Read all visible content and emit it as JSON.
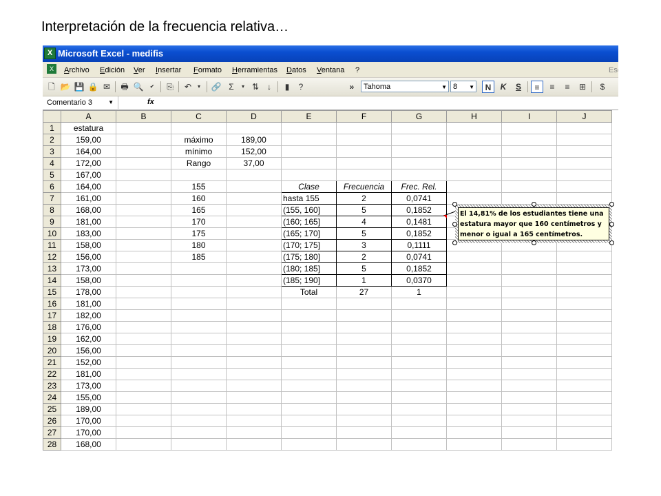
{
  "slide_title": "Interpretación de la frecuencia relativa…",
  "window": {
    "title": "Microsoft Excel - medifis"
  },
  "menu": [
    "Archivo",
    "Edición",
    "Ver",
    "Insertar",
    "Formato",
    "Herramientas",
    "Datos",
    "Ventana",
    "?"
  ],
  "help_box": "Esc",
  "toolbar": {
    "font_name": "Tahoma",
    "font_size": "8",
    "bold_label": "N",
    "italic_label": "K",
    "underline_label": "S",
    "sum_label": "Σ",
    "currency_label": "$",
    "more_label": "»"
  },
  "formula_bar": {
    "name_box": "Comentario 3",
    "fx": "fx"
  },
  "columns": [
    "A",
    "B",
    "C",
    "D",
    "E",
    "F",
    "G",
    "H",
    "I",
    "J"
  ],
  "rows": [
    {
      "n": "1",
      "A": "estatura",
      "C": "",
      "D": "",
      "E": "",
      "F": "",
      "G": ""
    },
    {
      "n": "2",
      "A": "159,00",
      "C": "máximo",
      "D": "189,00",
      "E": "",
      "F": "",
      "G": ""
    },
    {
      "n": "3",
      "A": "164,00",
      "C": "mínimo",
      "D": "152,00",
      "E": "",
      "F": "",
      "G": ""
    },
    {
      "n": "4",
      "A": "172,00",
      "C": "Rango",
      "D": "37,00",
      "E": "",
      "F": "",
      "G": ""
    },
    {
      "n": "5",
      "A": "167,00",
      "C": "",
      "D": "",
      "E": "",
      "F": "",
      "G": ""
    },
    {
      "n": "6",
      "A": "164,00",
      "C": "155",
      "D": "",
      "E": "Clase",
      "F": "Frecuencia",
      "G": "Frec. Rel."
    },
    {
      "n": "7",
      "A": "161,00",
      "C": "160",
      "D": "",
      "E": "hasta 155",
      "F": "2",
      "G": "0,0741"
    },
    {
      "n": "8",
      "A": "168,00",
      "C": "165",
      "D": "",
      "E": "(155, 160]",
      "F": "5",
      "G": "0,1852"
    },
    {
      "n": "9",
      "A": "181,00",
      "C": "170",
      "D": "",
      "E": "(160; 165]",
      "F": "4",
      "G": "0,1481"
    },
    {
      "n": "10",
      "A": "183,00",
      "C": "175",
      "D": "",
      "E": "(165; 170]",
      "F": "5",
      "G": "0,1852"
    },
    {
      "n": "11",
      "A": "158,00",
      "C": "180",
      "D": "",
      "E": "(170; 175]",
      "F": "3",
      "G": "0,1111"
    },
    {
      "n": "12",
      "A": "156,00",
      "C": "185",
      "D": "",
      "E": "(175; 180]",
      "F": "2",
      "G": "0,0741"
    },
    {
      "n": "13",
      "A": "173,00",
      "C": "",
      "D": "",
      "E": "(180; 185]",
      "F": "5",
      "G": "0,1852"
    },
    {
      "n": "14",
      "A": "158,00",
      "C": "",
      "D": "",
      "E": "(185; 190]",
      "F": "1",
      "G": "0,0370"
    },
    {
      "n": "15",
      "A": "178,00",
      "C": "",
      "D": "",
      "E": "Total",
      "F": "27",
      "G": "1"
    },
    {
      "n": "16",
      "A": "181,00",
      "C": "",
      "D": "",
      "E": "",
      "F": "",
      "G": ""
    },
    {
      "n": "17",
      "A": "182,00",
      "C": "",
      "D": "",
      "E": "",
      "F": "",
      "G": ""
    },
    {
      "n": "18",
      "A": "176,00",
      "C": "",
      "D": "",
      "E": "",
      "F": "",
      "G": ""
    },
    {
      "n": "19",
      "A": "162,00",
      "C": "",
      "D": "",
      "E": "",
      "F": "",
      "G": ""
    },
    {
      "n": "20",
      "A": "156,00",
      "C": "",
      "D": "",
      "E": "",
      "F": "",
      "G": ""
    },
    {
      "n": "21",
      "A": "152,00",
      "C": "",
      "D": "",
      "E": "",
      "F": "",
      "G": ""
    },
    {
      "n": "22",
      "A": "181,00",
      "C": "",
      "D": "",
      "E": "",
      "F": "",
      "G": ""
    },
    {
      "n": "23",
      "A": "173,00",
      "C": "",
      "D": "",
      "E": "",
      "F": "",
      "G": ""
    },
    {
      "n": "24",
      "A": "155,00",
      "C": "",
      "D": "",
      "E": "",
      "F": "",
      "G": ""
    },
    {
      "n": "25",
      "A": "189,00",
      "C": "",
      "D": "",
      "E": "",
      "F": "",
      "G": ""
    },
    {
      "n": "26",
      "A": "170,00",
      "C": "",
      "D": "",
      "E": "",
      "F": "",
      "G": ""
    },
    {
      "n": "27",
      "A": "170,00",
      "C": "",
      "D": "",
      "E": "",
      "F": "",
      "G": ""
    },
    {
      "n": "28",
      "A": "168,00",
      "C": "",
      "D": "",
      "E": "",
      "F": "",
      "G": ""
    }
  ],
  "comment": {
    "text": "El 14,81% de los estudiantes tiene una estatura mayor que 160 centímetros y menor o igual a 165 centímetros."
  }
}
